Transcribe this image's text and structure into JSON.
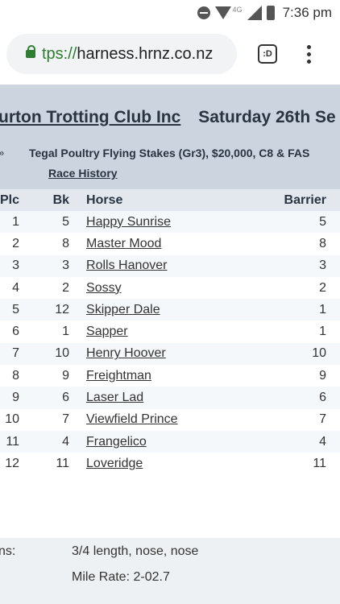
{
  "status_bar": {
    "time": "7:36 pm",
    "network_label": "4G"
  },
  "browser": {
    "url_scheme": "tps://",
    "url_host": "harness.hrnz.co.nz",
    "tab_switcher_label": ":D"
  },
  "header": {
    "club_name": "urton Trotting Club Inc",
    "date": "Saturday  26th  Se",
    "arrow": "»",
    "race_title": "Tegal Poultry Flying Stakes (Gr3), $20,000, C8 & FAS",
    "race_history_link": "Race History"
  },
  "table": {
    "columns": {
      "plc": "Plc",
      "bk": "Bk",
      "horse": "Horse",
      "barrier": "Barrier"
    },
    "rows": [
      {
        "plc": "1",
        "bk": "5",
        "horse": "Happy Sunrise",
        "barrier": "5"
      },
      {
        "plc": "2",
        "bk": "8",
        "horse": "Master Mood",
        "barrier": "8"
      },
      {
        "plc": "3",
        "bk": "3",
        "horse": "Rolls Hanover",
        "barrier": "3"
      },
      {
        "plc": "4",
        "bk": "2",
        "horse": "Sossy",
        "barrier": "2"
      },
      {
        "plc": "5",
        "bk": "12",
        "horse": "Skipper Dale",
        "barrier": "1"
      },
      {
        "plc": "6",
        "bk": "1",
        "horse": "Sapper",
        "barrier": "1"
      },
      {
        "plc": "7",
        "bk": "10",
        "horse": "Henry Hoover",
        "barrier": "10"
      },
      {
        "plc": "8",
        "bk": "9",
        "horse": "Freightman",
        "barrier": "9"
      },
      {
        "plc": "9",
        "bk": "6",
        "horse": "Laser Lad",
        "barrier": "6"
      },
      {
        "plc": "10",
        "bk": "7",
        "horse": "Viewfield Prince",
        "barrier": "7"
      },
      {
        "plc": "11",
        "bk": "4",
        "horse": "Frangelico",
        "barrier": "4"
      },
      {
        "plc": "12",
        "bk": "11",
        "horse": "Loveridge",
        "barrier": "11"
      }
    ]
  },
  "result_info": {
    "margins_label": "ns:",
    "margins_value": "3/4 length, nose, nose",
    "mile_rate": "Mile Rate: 2-02.7"
  }
}
